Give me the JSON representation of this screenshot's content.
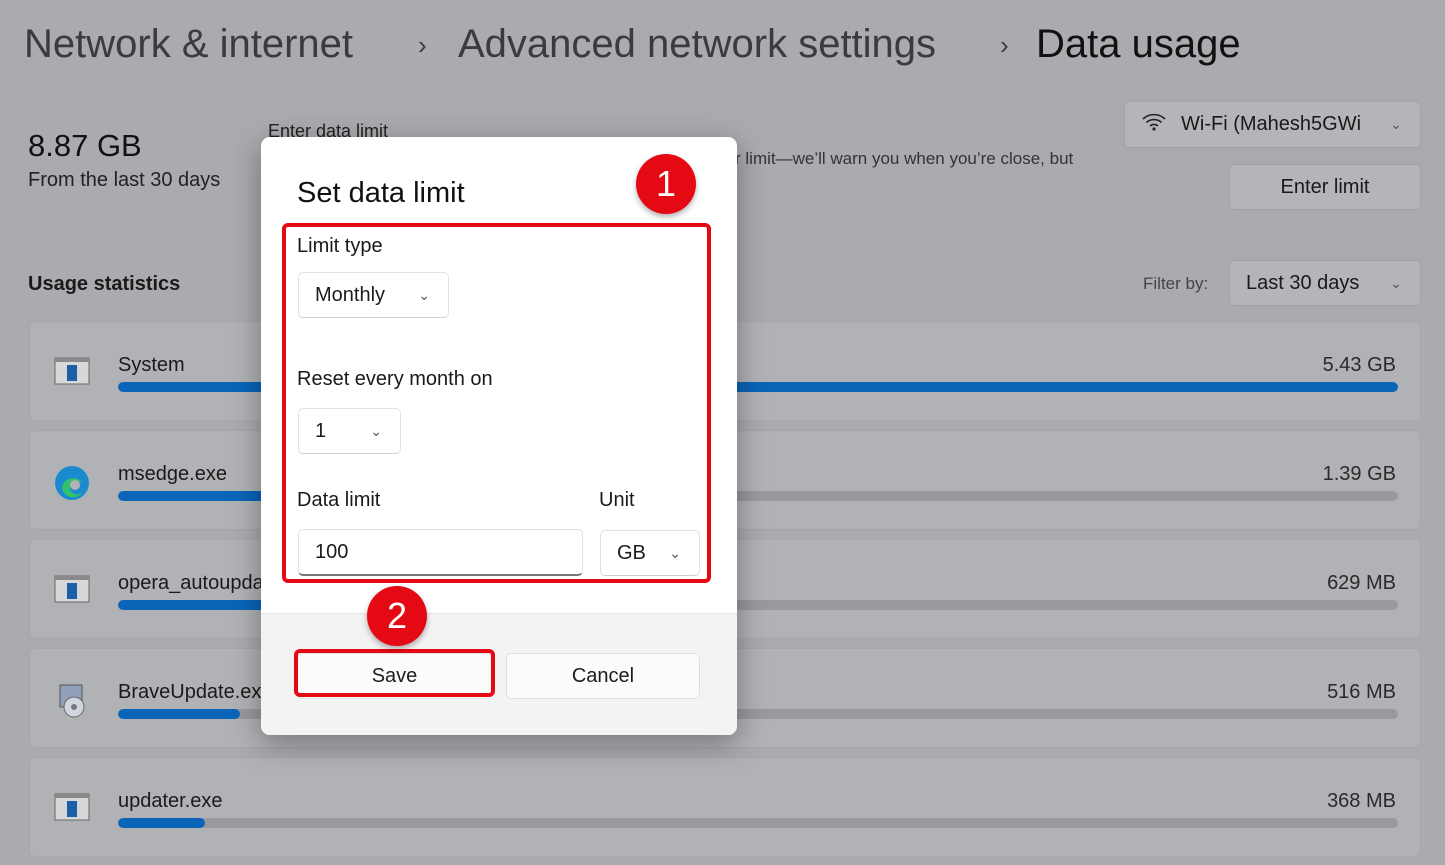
{
  "breadcrumb": {
    "items": [
      "Network & internet",
      "Advanced network settings",
      "Data usage"
    ]
  },
  "summary": {
    "total": "8.87 GB",
    "period": "From the last 30 days"
  },
  "limit_section": {
    "title": "Enter data limit",
    "description": "r limit—we’ll warn you when you’re close, but",
    "button": "Enter limit"
  },
  "network_select": {
    "value": "Wi-Fi (Mahesh5GWi",
    "icon": "wifi-icon"
  },
  "usage": {
    "title": "Usage statistics",
    "filter_label": "Filter by:",
    "filter_value": "Last 30 days",
    "apps": [
      {
        "name": "System",
        "size": "5.43 GB",
        "fraction": 1.0,
        "icon": "app-window-icon"
      },
      {
        "name": "msedge.exe",
        "size": "1.39 GB",
        "fraction": 0.256,
        "icon": "edge-icon"
      },
      {
        "name": "opera_autoupda",
        "size": "629 MB",
        "fraction": 0.116,
        "icon": "app-window-icon"
      },
      {
        "name": "BraveUpdate.ex",
        "size": "516 MB",
        "fraction": 0.095,
        "icon": "installer-icon"
      },
      {
        "name": "updater.exe",
        "size": "368 MB",
        "fraction": 0.068,
        "icon": "app-window-icon"
      }
    ]
  },
  "dialog": {
    "title": "Set data limit",
    "limit_type_label": "Limit type",
    "limit_type_value": "Monthly",
    "reset_label": "Reset every month on",
    "reset_value": "1",
    "data_limit_label": "Data limit",
    "data_limit_value": "100",
    "unit_label": "Unit",
    "unit_value": "GB",
    "save": "Save",
    "cancel": "Cancel"
  },
  "annotations": {
    "step1": "1",
    "step2": "2",
    "color": "#e50914"
  }
}
